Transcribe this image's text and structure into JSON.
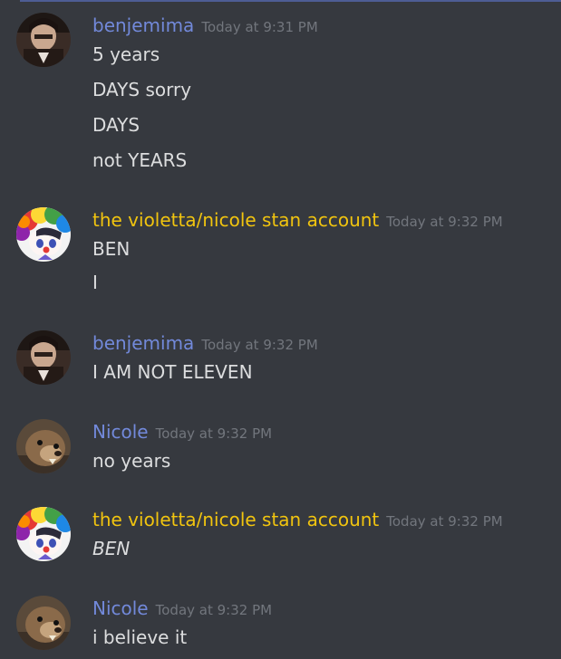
{
  "groups": [
    {
      "author": "benjemima",
      "timestamp": "Today at 9:31 PM",
      "avatar": "benjemima-avatar",
      "author_color": "#7289da",
      "messages": [
        "5 years",
        "DAYS sorry",
        "DAYS",
        "not YEARS"
      ]
    },
    {
      "author": "the violetta/nicole stan account",
      "timestamp": "Today at 9:32 PM",
      "avatar": "clown-anime-avatar",
      "author_color": "#f1c40f",
      "messages": [
        "BEN",
        "I"
      ]
    },
    {
      "author": "benjemima",
      "timestamp": "Today at 9:32 PM",
      "avatar": "benjemima-avatar",
      "author_color": "#7289da",
      "messages": [
        "I AM NOT ELEVEN"
      ]
    },
    {
      "author": "Nicole",
      "timestamp": "Today at 9:32 PM",
      "avatar": "groundhog-avatar",
      "author_color": "#7289da",
      "messages": [
        "no years"
      ]
    },
    {
      "author": "the violetta/nicole stan account",
      "timestamp": "Today at 9:32 PM",
      "avatar": "clown-anime-avatar",
      "author_color": "#f1c40f",
      "messages": [
        "BEN"
      ]
    },
    {
      "author": "Nicole",
      "timestamp": "Today at 9:32 PM",
      "avatar": "groundhog-avatar",
      "author_color": "#7289da",
      "messages": [
        "i believe it"
      ]
    }
  ],
  "theme": {
    "background": "#36393f",
    "text": "#dcddde",
    "timestamp": "#72767d"
  }
}
